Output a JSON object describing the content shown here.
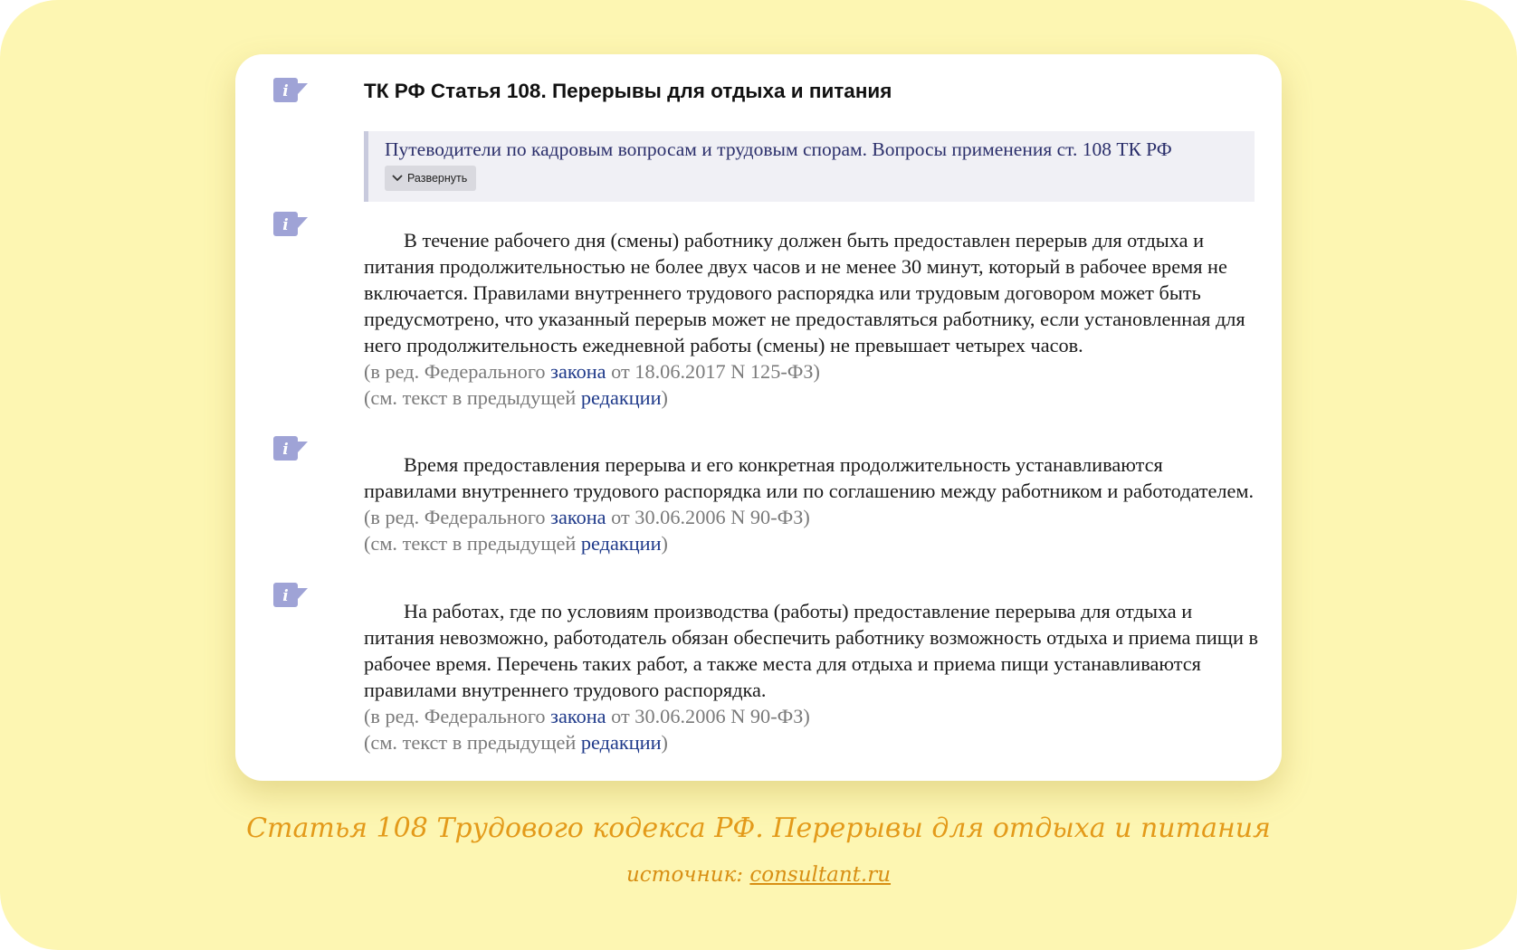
{
  "document": {
    "title": "ТК РФ Статья 108. Перерывы для отдыха и питания",
    "guide": {
      "text": "Путеводители по кадровым вопросам и трудовым спорам. Вопросы применения ст. 108 ТК РФ",
      "expand_label": "Развернуть"
    },
    "paragraphs": [
      {
        "text": "В течение рабочего дня (смены) работнику должен быть предоставлен перерыв для отдыха и питания продолжительностью не более двух часов и не менее 30 минут, который в рабочее время не включается. Правилами внутреннего трудового распорядка или трудовым договором может быть предусмотрено, что указанный перерыв может не предоставляться работнику, если установленная для него продолжительность ежедневной работы (смены) не превышает четырех часов.",
        "edition_prefix": "(в ред. Федерального ",
        "edition_link": "закона",
        "edition_suffix": " от 18.06.2017 N 125-ФЗ)",
        "prev_prefix": "(см. текст в предыдущей ",
        "prev_link": "редакции",
        "prev_suffix": ")"
      },
      {
        "text": "Время предоставления перерыва и его конкретная продолжительность устанавливаются правилами внутреннего трудового распорядка или по соглашению между работником и работодателем.",
        "edition_prefix": "(в ред. Федерального ",
        "edition_link": "закона",
        "edition_suffix": " от 30.06.2006 N 90-ФЗ)",
        "prev_prefix": "(см. текст в предыдущей ",
        "prev_link": "редакции",
        "prev_suffix": ")"
      },
      {
        "text": "На работах, где по условиям производства (работы) предоставление перерыва для отдыха и питания невозможно, работодатель обязан обеспечить работнику возможность отдыха и приема пищи в рабочее время. Перечень таких работ, а также места для отдыха и приема пищи устанавливаются правилами внутреннего трудового распорядка.",
        "edition_prefix": "(в ред. Федерального ",
        "edition_link": "закона",
        "edition_suffix": " от 30.06.2006 N 90-ФЗ)",
        "prev_prefix": "(см. текст в предыдущей ",
        "prev_link": "редакции",
        "prev_suffix": ")"
      }
    ]
  },
  "caption": {
    "title": "Статья 108 Трудового кодекса РФ. Перерывы для отдыха и питания",
    "source_prefix": "источник: ",
    "source_link": "consultant.ru"
  },
  "colors": {
    "background": "#fdf6b2",
    "caption": "#e39a1a",
    "link": "#1f3a8a",
    "icon": "#9fa3d6"
  },
  "icons": [
    "info-icon",
    "chevron-down-icon"
  ]
}
